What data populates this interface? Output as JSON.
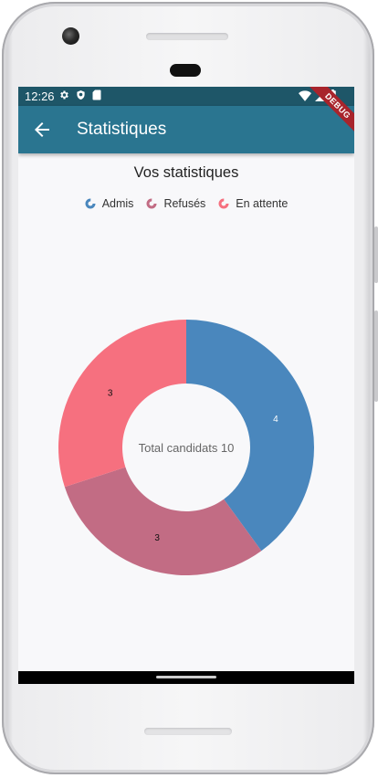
{
  "status_bar": {
    "time": "12:26",
    "left_icons": [
      "gear-icon",
      "shield-icon",
      "sd-card-icon"
    ],
    "right_icons": [
      "wifi-icon",
      "signal-icon",
      "battery-icon"
    ]
  },
  "app_bar": {
    "title": "Statistiques",
    "back_icon": "arrow-back-icon",
    "color": "#2a7590"
  },
  "debug_banner": "DEBUG",
  "page": {
    "heading": "Vos statistiques"
  },
  "legend": [
    {
      "label": "Admis",
      "color": "#4a87bd"
    },
    {
      "label": "Refusés",
      "color": "#c26c84"
    },
    {
      "label": "En attente",
      "color": "#f6707f"
    }
  ],
  "chart_data": {
    "type": "pie",
    "donut": true,
    "center_label": "Total candidats 10",
    "categories": [
      "Admis",
      "Refusés",
      "En attente"
    ],
    "values": [
      4,
      3,
      3
    ],
    "colors": [
      "#4a87bd",
      "#c26c84",
      "#f6707f"
    ],
    "data_labels": [
      "4",
      "3",
      "3"
    ],
    "legend_position": "top"
  }
}
